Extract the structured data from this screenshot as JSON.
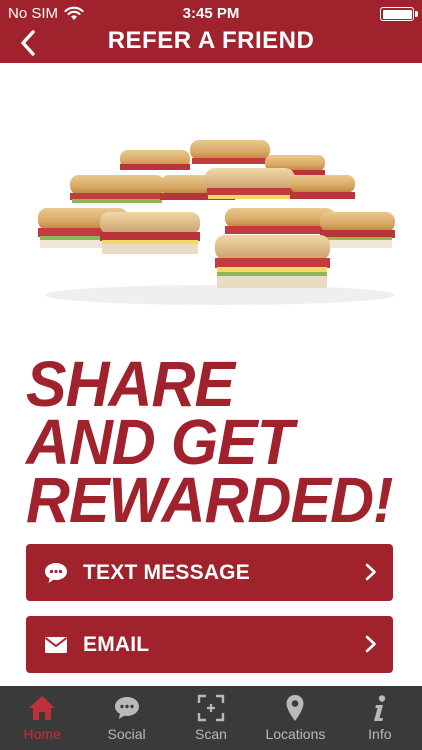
{
  "status_bar": {
    "carrier": "No SIM",
    "time": "3:45 PM"
  },
  "nav": {
    "title": "REFER A FRIEND"
  },
  "headline": {
    "line1": "SHARE",
    "line2": "AND GET",
    "line3": "REWARDED!"
  },
  "buttons": {
    "text_message": {
      "label": "TEXT MESSAGE",
      "icon": "chat-bubble-icon"
    },
    "email": {
      "label": "EMAIL",
      "icon": "envelope-icon"
    }
  },
  "tabs": [
    {
      "label": "Home",
      "icon": "home-icon",
      "active": true
    },
    {
      "label": "Social",
      "icon": "chat-bubble-icon",
      "active": false
    },
    {
      "label": "Scan",
      "icon": "scan-icon",
      "active": false
    },
    {
      "label": "Locations",
      "icon": "map-pin-icon",
      "active": false
    },
    {
      "label": "Info",
      "icon": "info-icon",
      "active": false
    }
  ],
  "colors": {
    "brand": "#a0222d",
    "tabbar": "#3a3a3a",
    "tab_inactive": "#b9b9b9",
    "tab_active": "#c0303a"
  }
}
